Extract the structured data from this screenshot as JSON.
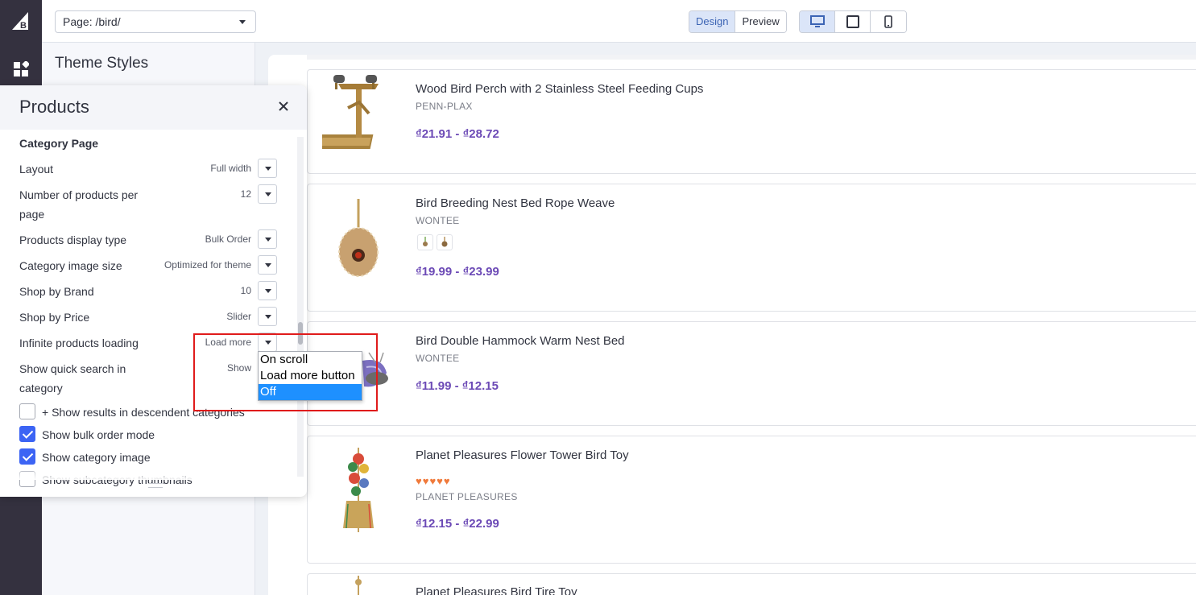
{
  "topbar": {
    "page_select_value": "Page: /bird/",
    "mode_design": "Design",
    "mode_preview": "Preview"
  },
  "theme_panel": {
    "title": "Theme Styles"
  },
  "products_panel": {
    "title": "Products",
    "section_title": "Category Page",
    "settings": [
      {
        "label": "Layout",
        "value": "Full width"
      },
      {
        "label": "Number of products per page",
        "value": "12"
      },
      {
        "label": "Products display type",
        "value": "Bulk Order"
      },
      {
        "label": "Category image size",
        "value": "Optimized for theme"
      },
      {
        "label": "Shop by Brand",
        "value": "10"
      },
      {
        "label": "Shop by Price",
        "value": "Slider"
      },
      {
        "label": "Infinite products loading",
        "value": "Load more"
      },
      {
        "label": "Show quick search in category",
        "value": "Show"
      }
    ],
    "checkboxes": [
      {
        "label": "+ Show results in descendent categories",
        "checked": false
      },
      {
        "label": "Show bulk order mode",
        "checked": true
      },
      {
        "label": "Show category image",
        "checked": true
      },
      {
        "label": "Show subcategory thumbnails",
        "checked": false
      }
    ]
  },
  "dropdown": {
    "options": [
      "On scroll",
      "Load more button",
      "Off"
    ],
    "highlighted": "Off"
  },
  "products": [
    {
      "name": "Wood Bird Perch with 2 Stainless Steel Feeding Cups",
      "brand": "PENN-PLAX",
      "price": "₫21.91 - ₫28.72"
    },
    {
      "name": "Bird Breeding Nest Bed Rope Weave",
      "brand": "WONTEE",
      "price": "₫19.99 - ₫23.99"
    },
    {
      "name": "Bird Double Hammock Warm Nest Bed",
      "brand": "WONTEE",
      "price": "₫11.99 - ₫12.15"
    },
    {
      "name": "Planet Pleasures Flower Tower Bird Toy",
      "brand": "PLANET PLEASURES",
      "price": "₫12.15 - ₫22.99",
      "rating": "♥♥♥♥♥"
    },
    {
      "name": "Planet Pleasures Bird Tire Toy"
    }
  ],
  "colors": {
    "accent": "#3c64f4",
    "price": "#6c4ab6",
    "highlight_border": "#e01b1b",
    "rail": "#34313f"
  }
}
